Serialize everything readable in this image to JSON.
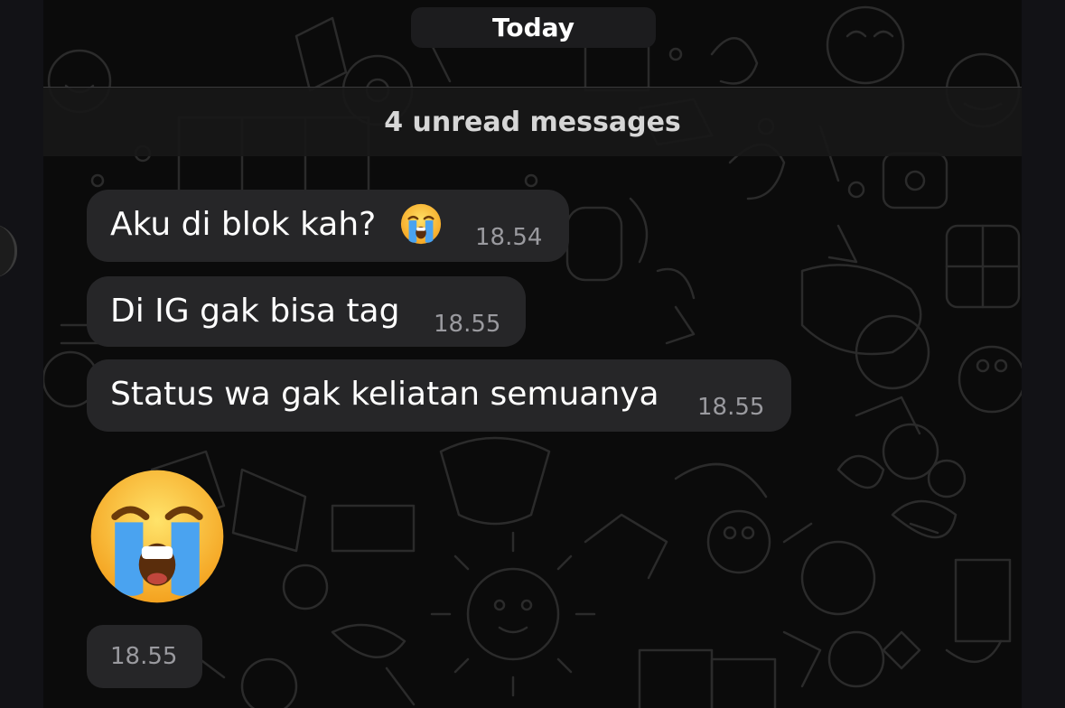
{
  "chat": {
    "date_separator": "Today",
    "unread_banner": "4 unread messages",
    "messages": [
      {
        "text": "Aku di blok kah?",
        "emoji": "loudly-crying-face",
        "time": "18.54"
      },
      {
        "text": "Di IG gak bisa tag",
        "time": "18.55"
      },
      {
        "text": "Status wa gak keliatan semuanya",
        "time": "18.55"
      },
      {
        "sticker": "loudly-crying-face",
        "time": "18.55"
      }
    ]
  },
  "colors": {
    "background": "#0b0b0b",
    "bubble": "#262628",
    "timestamp": "#9a9a9f",
    "doodle": "#2b2b2b"
  }
}
